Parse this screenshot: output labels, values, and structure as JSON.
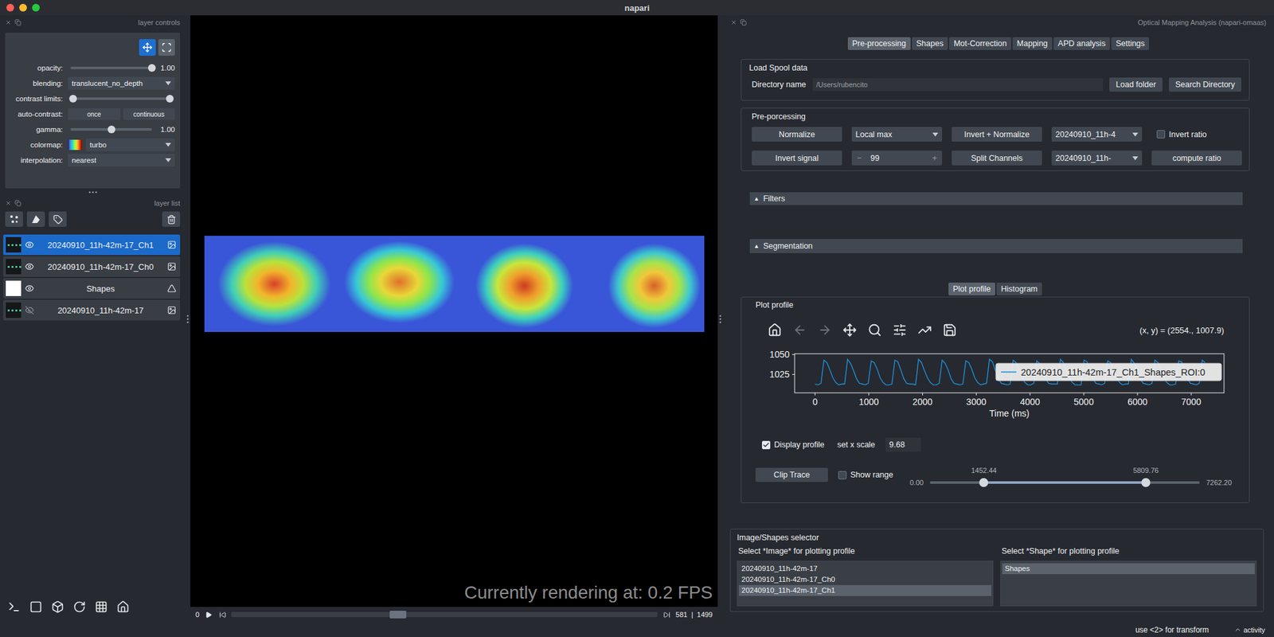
{
  "window": {
    "title": "napari"
  },
  "layer_controls": {
    "title": "layer controls",
    "modes": [
      {
        "selected": true
      },
      {
        "selected": false
      }
    ],
    "rows": [
      {
        "label": "opacity:",
        "kind": "slider",
        "level": 1,
        "reading": "1.00"
      },
      {
        "label": "blending:",
        "kind": "dropdown",
        "value": "translucent_no_depth"
      },
      {
        "label": "contrast limits:",
        "kind": "range",
        "low": 0,
        "high": 1
      },
      {
        "label": "auto-contrast:",
        "kind": "buttons",
        "buttons": [
          "once",
          "continuous"
        ]
      },
      {
        "label": "gamma:",
        "kind": "slider",
        "level": 0.5,
        "reading": "1.00"
      },
      {
        "label": "colormap:",
        "kind": "colormap",
        "value": "turbo"
      },
      {
        "label": "interpolation:",
        "kind": "dropdown",
        "value": "nearest"
      }
    ]
  },
  "layer_list": {
    "title": "layer list",
    "layers": [
      {
        "name": "20240910_11h-42m-17_Ch1",
        "kind": "image",
        "selected": true,
        "visible": true
      },
      {
        "name": "20240910_11h-42m-17_Ch0",
        "kind": "image",
        "selected": false,
        "visible": true
      },
      {
        "name": "Shapes",
        "kind": "shapes",
        "selected": false,
        "visible": true
      },
      {
        "name": "20240910_11h-42m-17",
        "kind": "image",
        "selected": false,
        "visible": false
      }
    ]
  },
  "canvas": {
    "fps_text": "Currently rendering at: 0.2 FPS"
  },
  "dims": {
    "frame_label": "0",
    "level": 0.39,
    "current": "581",
    "separator": "|",
    "total": "1499"
  },
  "plugin": {
    "title": "Optical Mapping Analysis (napari-omaas)",
    "tabs": [
      {
        "label": "Pre-processing",
        "selected": true
      },
      {
        "label": "Shapes",
        "selected": false
      },
      {
        "label": "Mot-Correction",
        "selected": false
      },
      {
        "label": "Mapping",
        "selected": false
      },
      {
        "label": "APD analysis",
        "selected": false
      },
      {
        "label": "Settings",
        "selected": false
      }
    ],
    "load": {
      "title": "Load Spool data",
      "label": "Directory name",
      "value": "/Users/rubencito",
      "buttons": [
        "Load folder",
        "Search Directory"
      ]
    },
    "preprocessing": {
      "title": "Pre-porcessing",
      "rows": [
        [
          {
            "kind": "button",
            "label": "Normalize"
          },
          {
            "kind": "dropdown",
            "value": "Local max"
          },
          {
            "kind": "button",
            "label": "Invert + Normalize"
          },
          {
            "kind": "dropdown",
            "value": "20240910_11h-4"
          },
          {
            "kind": "checkbox",
            "label": "Invert ratio",
            "checked": false
          }
        ],
        [
          {
            "kind": "button",
            "label": "Invert signal"
          },
          {
            "kind": "spinbox",
            "minus": "−",
            "value": "99",
            "plus": "+"
          },
          {
            "kind": "button",
            "label": "Split Channels"
          },
          {
            "kind": "dropdown",
            "value": "20240910_11h-"
          },
          {
            "kind": "button",
            "label": "compute ratio"
          }
        ]
      ]
    },
    "sections": [
      {
        "icon": "▲",
        "label": "Filters",
        "expanded": false
      },
      {
        "icon": "▲",
        "label": "Segmentation",
        "expanded": false
      }
    ],
    "subtabs": [
      {
        "label": "Plot profile",
        "selected": true
      },
      {
        "label": "Histogram",
        "selected": false
      }
    ],
    "plot": {
      "title": "Plot profile",
      "toolbar": [
        {
          "disabled": false
        },
        {
          "disabled": true
        },
        {
          "disabled": true
        },
        {
          "disabled": false
        },
        {
          "disabled": false
        },
        {
          "disabled": false
        },
        {
          "disabled": false
        },
        {
          "disabled": false
        }
      ],
      "coords": "(x, y) = (2554., 1007.9)",
      "chart": {
        "y_ticks": [
          "1025",
          "1050"
        ],
        "x_ticks": [
          "0",
          "1000",
          "2000",
          "3000",
          "4000",
          "5000",
          "6000",
          "7000"
        ],
        "x_label": "Time (ms)",
        "sample_ms": 55,
        "series": [
          {
            "name": "20240910_11h-42m-17_Ch1_Shapes_ROI:0",
            "values": [
              1013,
              1012,
              1014,
              1043,
              1040,
              1031,
              1021,
              1015,
              1012,
              1013,
              1013,
              1044,
              1039,
              1030,
              1020,
              1014,
              1013,
              1012,
              1014,
              1042,
              1040,
              1032,
              1021,
              1015,
              1012,
              1012,
              1013,
              1043,
              1041,
              1031,
              1020,
              1014,
              1013,
              1013,
              1012,
              1044,
              1040,
              1030,
              1021,
              1015,
              1012,
              1012,
              1014,
              1043,
              1039,
              1031,
              1020,
              1014,
              1013,
              1012,
              1013,
              1042,
              1040,
              1032,
              1021,
              1015,
              1012,
              1013,
              1014,
              1044,
              1041,
              1030,
              1020,
              1014,
              1013,
              1012,
              1013,
              1043,
              1040,
              1031,
              1021,
              1015,
              1012,
              1012,
              1014,
              1042,
              1039,
              1032,
              1020,
              1014,
              1013,
              1013,
              1013,
              1044,
              1040,
              1031,
              1021,
              1015,
              1012,
              1012,
              1012,
              1043,
              1041,
              1030,
              1020,
              1014,
              1013,
              1012,
              1014,
              1042,
              1040,
              1031,
              1021,
              1015,
              1012,
              1013,
              1013,
              1044,
              1039,
              1032,
              1020,
              1014,
              1013,
              1012,
              1014,
              1043,
              1040,
              1031,
              1021,
              1015,
              1012,
              1012,
              1013,
              1042,
              1041,
              1030,
              1020,
              1014,
              1013,
              1012,
              1014,
              1043,
              1040
            ]
          }
        ]
      },
      "display_profile": {
        "label": "Display profile",
        "checked": true
      },
      "x_scale": {
        "label": "set x scale",
        "value": "9.68"
      },
      "clip": {
        "button": "Clip Trace",
        "show_range": {
          "label": "Show range",
          "checked": false
        },
        "min": "0.00",
        "max": "7262.20",
        "low": {
          "reading": "1452.44",
          "level": 0.2
        },
        "high": {
          "reading": "5809.76",
          "level": 0.8
        }
      }
    },
    "selector": {
      "title": "Image/Shapes selector",
      "columns": [
        {
          "label": "Select *Image* for plotting profile",
          "items": [
            {
              "label": "20240910_11h-42m-17",
              "selected": false
            },
            {
              "label": "20240910_11h-42m-17_Ch0",
              "selected": false
            },
            {
              "label": "20240910_11h-42m-17_Ch1",
              "selected": true
            }
          ]
        },
        {
          "label": "Select *Shape* for plotting profile",
          "items": [
            {
              "label": "Shapes",
              "selected": true
            }
          ]
        }
      ]
    }
  },
  "status_bar": {
    "hint": "use <2> for transform",
    "activity": "activity"
  }
}
